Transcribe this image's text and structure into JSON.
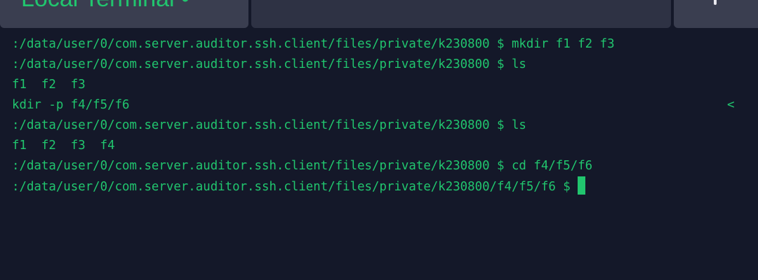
{
  "tabs": {
    "active_label": "Local Terminal",
    "active_suffix": "•"
  },
  "terminal": {
    "lines": [
      ":/data/user/0/com.server.auditor.ssh.client/files/private/k230800 $ mkdir f1 f2 f3",
      ":/data/user/0/com.server.auditor.ssh.client/files/private/k230800 $ ls",
      "f1  f2  f3",
      "kdir -p f4/f5/f6",
      ":/data/user/0/com.server.auditor.ssh.client/files/private/k230800 $ ls",
      "f1  f2  f3  f4",
      ":/data/user/0/com.server.auditor.ssh.client/files/private/k230800 $ cd f4/f5/f6",
      ":/data/user/0/com.server.auditor.ssh.client/files/private/k230800/f4/f5/f6 $ "
    ],
    "scroll_marker": "<",
    "text_color": "#21c56e",
    "background": "#141829"
  }
}
